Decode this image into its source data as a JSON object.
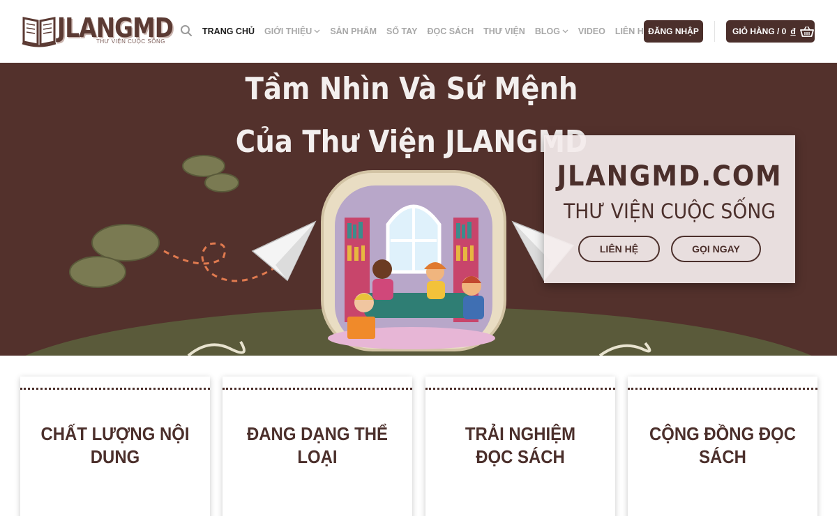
{
  "brand": {
    "logo_text": "JLANGMD",
    "logo_tagline": "THƯ VIỆN CUỘC SỐNG"
  },
  "header": {
    "nav": [
      {
        "label": "TRANG CHỦ",
        "active": true,
        "dropdown": false
      },
      {
        "label": "GIỚI THIỆU",
        "active": false,
        "dropdown": true
      },
      {
        "label": "SẢN PHẨM",
        "active": false,
        "dropdown": false
      },
      {
        "label": "SỔ TAY",
        "active": false,
        "dropdown": false
      },
      {
        "label": "ĐỌC SÁCH",
        "active": false,
        "dropdown": false
      },
      {
        "label": "THƯ VIỆN",
        "active": false,
        "dropdown": false
      },
      {
        "label": "BLOG",
        "active": false,
        "dropdown": true
      },
      {
        "label": "VIDEO",
        "active": false,
        "dropdown": false
      },
      {
        "label": "LIÊN HỆ",
        "active": false,
        "dropdown": false
      }
    ],
    "login_label": "ĐĂNG NHẬP",
    "cart_label": "GIỎ HÀNG / 0",
    "cart_currency": "đ"
  },
  "hero": {
    "title_line1": "Tầm Nhìn Và Sứ Mệnh",
    "title_line2": "Của Thư Viện JLANGMD",
    "box_heading": "JLANGMD.COM",
    "box_subheading": "THƯ VIỆN CUỘC SỐNG",
    "contact_button": "LIÊN HỆ",
    "call_button": "GỌI NGAY"
  },
  "cards": [
    {
      "title": "CHẤT LƯỢNG NỘI DUNG"
    },
    {
      "title": "ĐANG DẠNG THỂ LOẠI"
    },
    {
      "title": "TRẢI NGHIỆM ĐỌC SÁCH"
    },
    {
      "title": "CỘNG ĐỒNG ĐỌC SÁCH"
    }
  ],
  "colors": {
    "brand_brown": "#4b2f2b",
    "hero_bg": "#53312c",
    "ground_olive": "#5a5a3a",
    "cloud_olive": "#7a7a52"
  },
  "icons": {
    "search": "search-icon",
    "cart": "basket-icon",
    "dropdown": "chevron-down-icon",
    "logo": "open-book-icon"
  }
}
